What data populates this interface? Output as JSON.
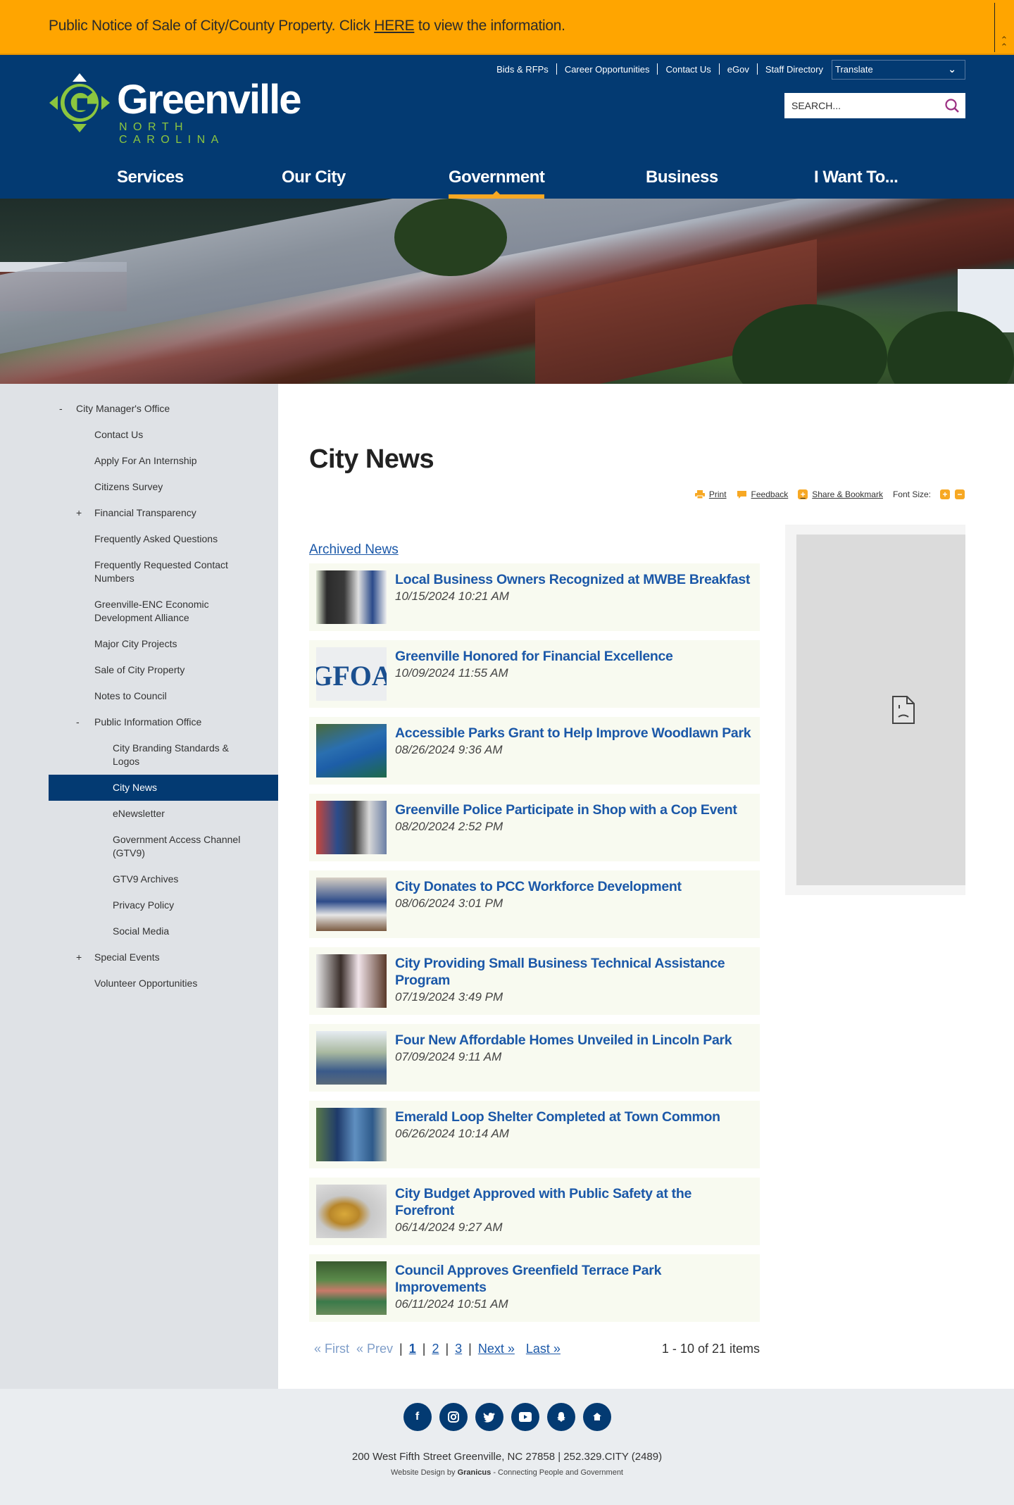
{
  "alert": {
    "text_before": "Public Notice of Sale of City/County Property. Click ",
    "link": "HERE",
    "text_after": " to view the information.",
    "collapse_icon": "double-chevron-up"
  },
  "header": {
    "logo_name": "Greenville",
    "logo_sub": "NORTH CAROLINA",
    "utility_links": [
      "Bids & RFPs",
      "Career Opportunities",
      "Contact Us",
      "eGov",
      "Staff Directory"
    ],
    "translate_label": "Translate",
    "search_placeholder": "SEARCH...",
    "nav": [
      "Services",
      "Our City",
      "Government",
      "Business",
      "I Want To..."
    ],
    "active_nav": "Government"
  },
  "colors": {
    "alert_bg": "#ffa500",
    "brand_navy": "#033a72",
    "accent_orange": "#f7a823",
    "logo_green": "#8cc63f",
    "link_blue": "#1b58a8"
  },
  "sidebar": {
    "items": [
      {
        "label": "City Manager's Office",
        "level": 1,
        "toggle": "-"
      },
      {
        "label": "Contact Us",
        "level": 2,
        "toggle": ""
      },
      {
        "label": "Apply For An Internship",
        "level": 2,
        "toggle": ""
      },
      {
        "label": "Citizens Survey",
        "level": 2,
        "toggle": ""
      },
      {
        "label": "Financial Transparency",
        "level": 2,
        "toggle": "+"
      },
      {
        "label": "Frequently Asked Questions",
        "level": 2,
        "toggle": ""
      },
      {
        "label": "Frequently Requested Contact Numbers",
        "level": 2,
        "toggle": ""
      },
      {
        "label": "Greenville-ENC Economic Development Alliance",
        "level": 2,
        "toggle": ""
      },
      {
        "label": "Major City Projects",
        "level": 2,
        "toggle": ""
      },
      {
        "label": "Sale of City Property",
        "level": 2,
        "toggle": ""
      },
      {
        "label": "Notes to Council",
        "level": 2,
        "toggle": ""
      },
      {
        "label": "Public Information Office",
        "level": 2,
        "toggle": "-"
      },
      {
        "label": "City Branding Standards & Logos",
        "level": 3,
        "toggle": ""
      },
      {
        "label": "City News",
        "level": 3,
        "toggle": "",
        "active": true
      },
      {
        "label": "eNewsletter",
        "level": 3,
        "toggle": ""
      },
      {
        "label": "Government Access Channel (GTV9)",
        "level": 3,
        "toggle": ""
      },
      {
        "label": "GTV9 Archives",
        "level": 3,
        "toggle": ""
      },
      {
        "label": "Privacy Policy",
        "level": 3,
        "toggle": ""
      },
      {
        "label": "Social Media",
        "level": 3,
        "toggle": ""
      },
      {
        "label": "Special Events",
        "level": 2,
        "toggle": "+"
      },
      {
        "label": "Volunteer Opportunities",
        "level": 2,
        "toggle": ""
      }
    ]
  },
  "main": {
    "title": "City News",
    "tools": {
      "print": "Print",
      "feedback": "Feedback",
      "share": "Share & Bookmark",
      "font_size_label": "Font Size:",
      "increase": "+",
      "decrease": "−"
    },
    "archived_link": "Archived News",
    "news": [
      {
        "title": "Local Business Owners Recognized at MWBE Breakfast",
        "date": "10/15/2024 10:21 AM",
        "thumb": "people-award-photo"
      },
      {
        "title": "Greenville Honored for Financial Excellence",
        "date": "10/09/2024 11:55 AM",
        "thumb": "gfoa-logo"
      },
      {
        "title": "Accessible Parks Grant to Help Improve Woodlawn Park",
        "date": "08/26/2024 9:36 AM",
        "thumb": "playground-photo"
      },
      {
        "title": "Greenville Police Participate in Shop with a Cop Event",
        "date": "08/20/2024 2:52 PM",
        "thumb": "store-photo"
      },
      {
        "title": "City Donates to PCC Workforce Development",
        "date": "08/06/2024 3:01 PM",
        "thumb": "check-presentation-photo"
      },
      {
        "title": "City Providing Small Business Technical Assistance Program",
        "date": "07/19/2024 3:49 PM",
        "thumb": "business-meeting-photo"
      },
      {
        "title": "Four New Affordable Homes Unveiled in Lincoln Park",
        "date": "07/09/2024 9:11 AM",
        "thumb": "homes-photo"
      },
      {
        "title": "Emerald Loop Shelter Completed at Town Common",
        "date": "06/26/2024 10:14 AM",
        "thumb": "shelter-photo"
      },
      {
        "title": "City Budget Approved with Public Safety at the Forefront",
        "date": "06/14/2024 9:27 AM",
        "thumb": "badge-photo"
      },
      {
        "title": "Council Approves Greenfield Terrace Park Improvements",
        "date": "06/11/2024 10:51 AM",
        "thumb": "park-aerial-photo"
      }
    ],
    "pager": {
      "first": "« First",
      "prev": "« Prev",
      "pages": [
        "1",
        "2",
        "3"
      ],
      "current": "1",
      "next": "Next »",
      "last": "Last »",
      "count": "1 - 10 of 21 items"
    }
  },
  "footer": {
    "socials": [
      "facebook",
      "instagram",
      "twitter",
      "youtube",
      "snapchat",
      "nextdoor"
    ],
    "address": "200 West Fifth Street Greenville, NC 27858 | 252.329.CITY (2489)",
    "credit_before": "Website Design by ",
    "credit_brand": "Granicus",
    "credit_after": " - Connecting People and Government"
  }
}
